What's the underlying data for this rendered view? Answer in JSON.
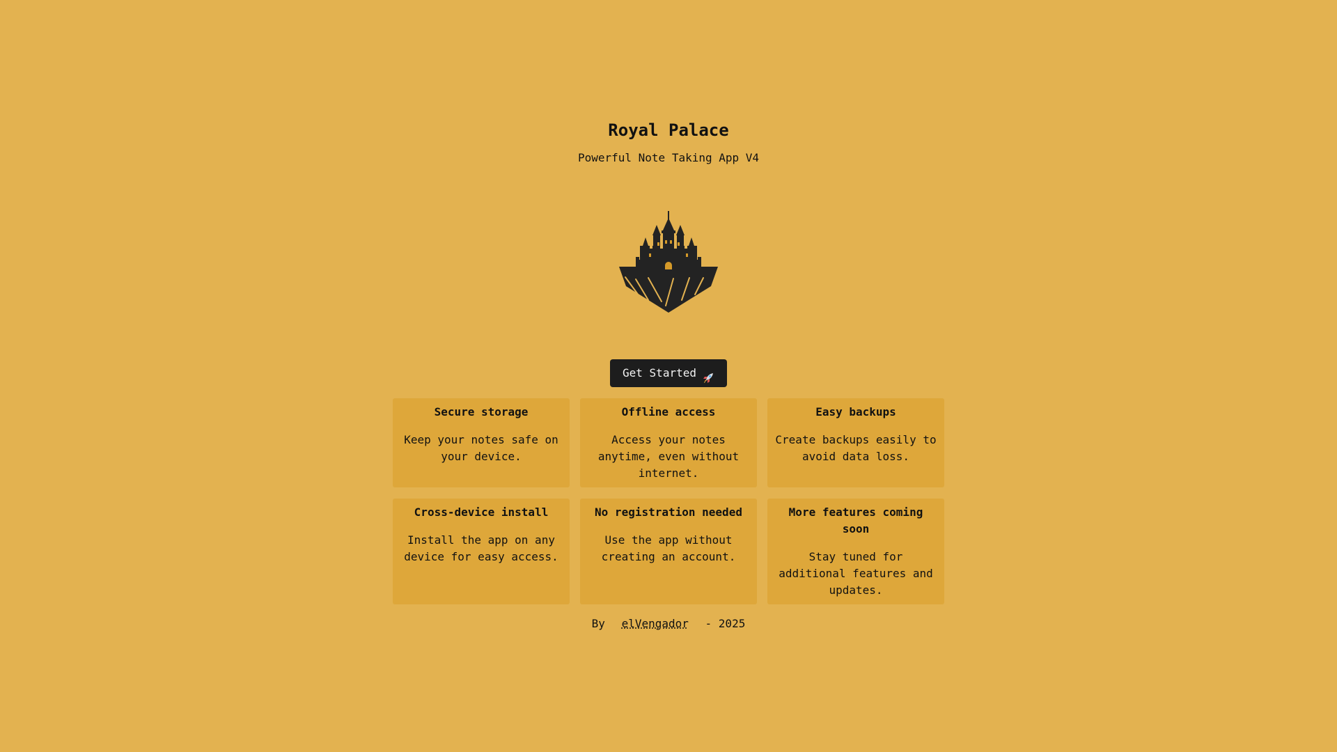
{
  "hero": {
    "title": "Royal Palace",
    "subtitle": "Powerful Note Taking App V4",
    "logo_icon": "castle-icon",
    "cta_label": "Get Started",
    "cta_icon": "rocket-icon"
  },
  "features": [
    {
      "title": "Secure storage",
      "description": "Keep your notes safe on your device."
    },
    {
      "title": "Offline access",
      "description": "Access your notes anytime, even without internet."
    },
    {
      "title": "Easy backups",
      "description": "Create backups easily to avoid data loss."
    },
    {
      "title": "Cross-device install",
      "description": "Install the app on any device for easy access."
    },
    {
      "title": "No registration needed",
      "description": "Use the app without creating an account."
    },
    {
      "title": "More features coming soon",
      "description": "Stay tuned for additional features and updates."
    }
  ],
  "footer": {
    "prefix": "By",
    "author": "elVengador",
    "suffix": "- 2025"
  },
  "colors": {
    "background": "#e3b250",
    "card": "#dea73a",
    "button": "#1d1d1d",
    "text": "#111111"
  }
}
